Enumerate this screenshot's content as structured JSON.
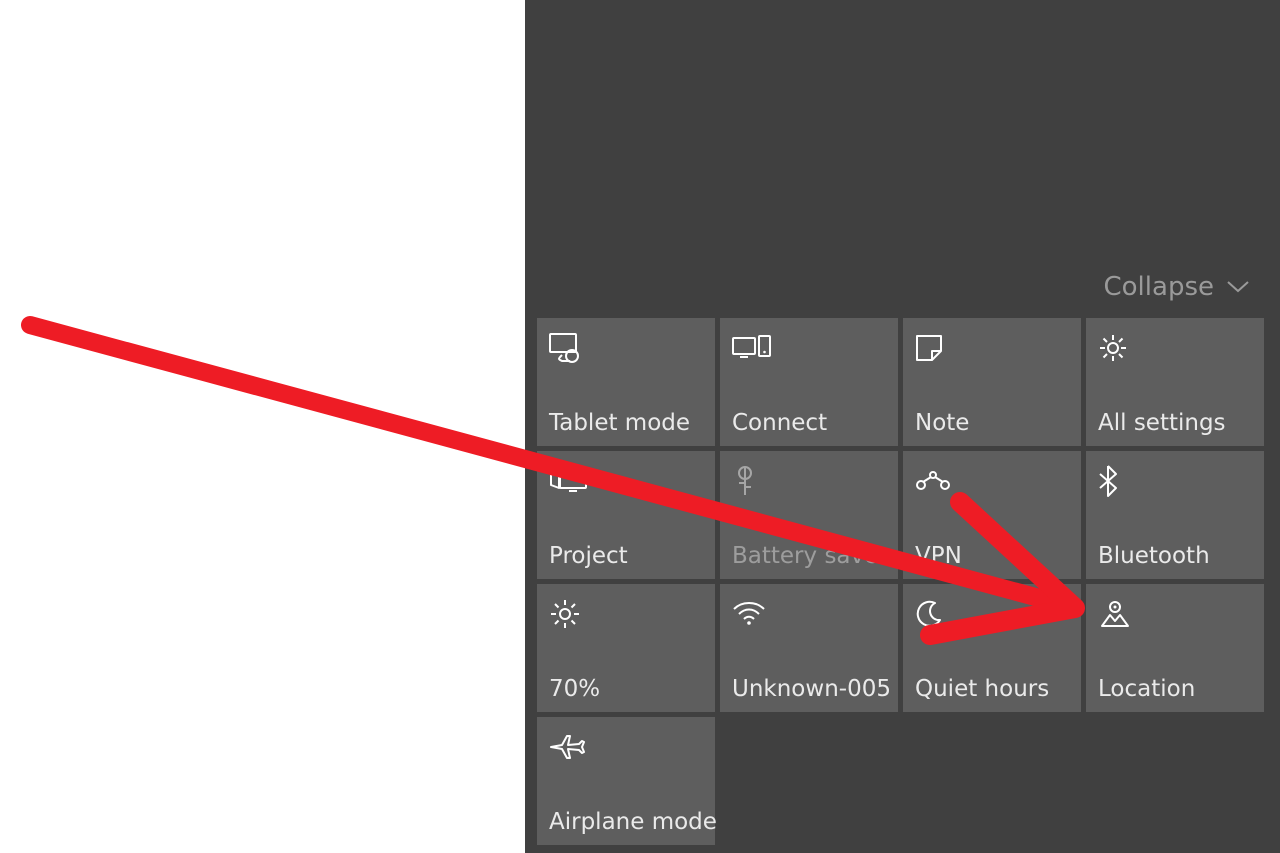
{
  "collapse": {
    "label": "Collapse"
  },
  "tiles": {
    "tablet": {
      "label": "Tablet mode"
    },
    "connect": {
      "label": "Connect"
    },
    "note": {
      "label": "Note"
    },
    "settings": {
      "label": "All settings"
    },
    "project": {
      "label": "Project"
    },
    "battery": {
      "label": "Battery saver"
    },
    "vpn": {
      "label": "VPN"
    },
    "bluetooth": {
      "label": "Bluetooth"
    },
    "bright": {
      "label": "70%"
    },
    "wifi": {
      "label": "Unknown-005"
    },
    "quiet": {
      "label": "Quiet hours"
    },
    "location": {
      "label": "Location"
    },
    "airplane": {
      "label": "Airplane mode"
    }
  }
}
